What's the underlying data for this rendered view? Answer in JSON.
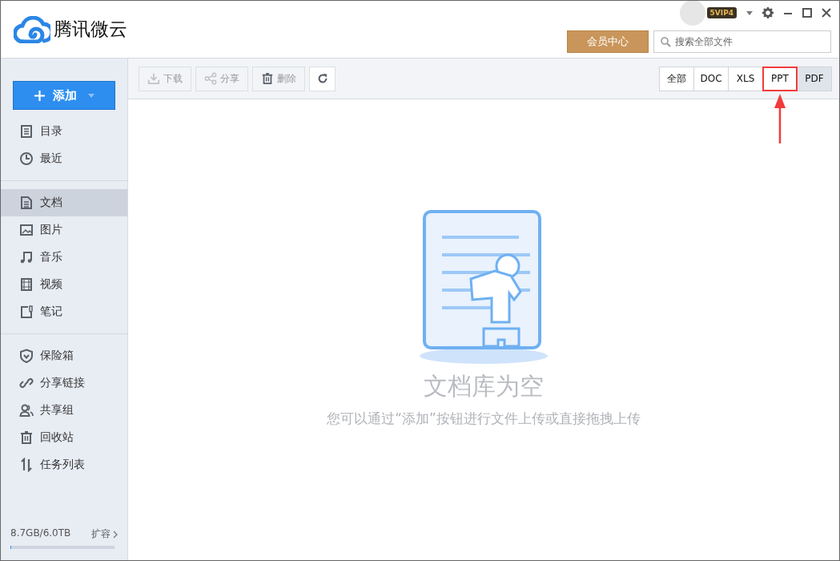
{
  "app": {
    "name": "腾讯微云",
    "badge": "5VIP4"
  },
  "header": {
    "member_button": "会员中心",
    "search": {
      "placeholder": "搜索全部文件"
    }
  },
  "add_button": {
    "label": "添加"
  },
  "sidebar": {
    "groups": [
      [
        {
          "label": "目录",
          "selected": false
        },
        {
          "label": "最近",
          "selected": false
        }
      ],
      [
        {
          "label": "文档",
          "selected": true
        },
        {
          "label": "图片",
          "selected": false
        },
        {
          "label": "音乐",
          "selected": false
        },
        {
          "label": "视频",
          "selected": false
        },
        {
          "label": "笔记",
          "selected": false
        }
      ],
      [
        {
          "label": "保险箱",
          "selected": false
        },
        {
          "label": "分享链接",
          "selected": false
        },
        {
          "label": "共享组",
          "selected": false
        },
        {
          "label": "回收站",
          "selected": false
        },
        {
          "label": "任务列表",
          "selected": false
        }
      ]
    ]
  },
  "storage": {
    "usage": "8.7GB/6.0TB",
    "expand": "扩容",
    "level": 0.01
  },
  "toolbar": [
    {
      "label": "下载",
      "disabled": true
    },
    {
      "label": "分享",
      "disabled": true
    },
    {
      "label": "删除",
      "disabled": true
    },
    {
      "disabled": false
    }
  ],
  "filters": [
    {
      "label": "全部",
      "hovered": false,
      "highlighted": false
    },
    {
      "label": "DOC",
      "hovered": false,
      "highlighted": false
    },
    {
      "label": "XLS",
      "hovered": false,
      "highlighted": false
    },
    {
      "label": "PPT",
      "hovered": false,
      "highlighted": true
    },
    {
      "label": "PDF",
      "hovered": true,
      "highlighted": false
    }
  ],
  "empty_state": {
    "title": "文档库为空",
    "message": "您可以通过“添加”按钮进行文件上传或直接拖拽上传"
  }
}
